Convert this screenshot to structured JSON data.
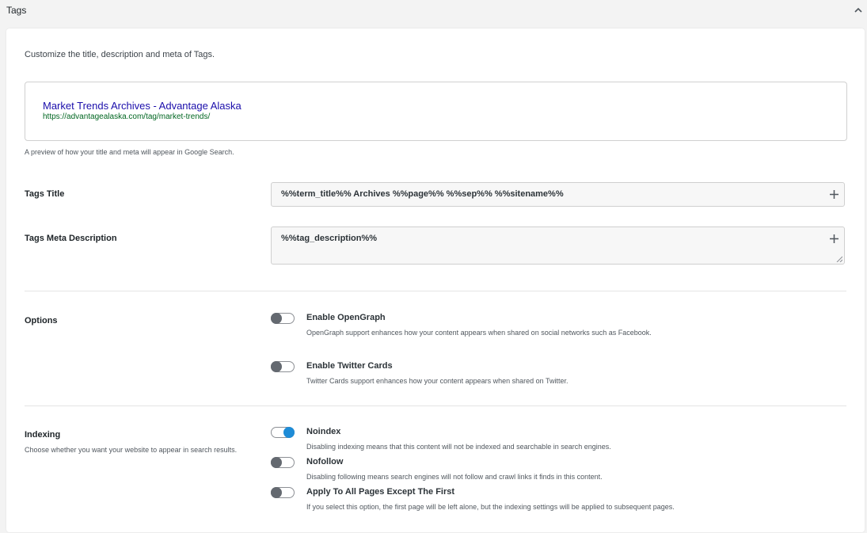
{
  "section": {
    "title": "Tags",
    "collapse_icon": "chevron-up-icon"
  },
  "card": {
    "intro": "Customize the title, description and meta of Tags.",
    "preview": {
      "title": "Market Trends Archives - Advantage Alaska",
      "url": "https://advantagealaska.com/tag/market-trends/",
      "help": "A preview of how your title and meta will appear in Google Search."
    },
    "fields": {
      "title_label": "Tags Title",
      "title_value": "%%term_title%% Archives %%page%% %%sep%% %%sitename%%",
      "description_label": "Tags Meta Description",
      "description_value": "%%tag_description%%",
      "add_icon": "plus-icon"
    },
    "options": {
      "label": "Options",
      "items": [
        {
          "label": "Enable OpenGraph",
          "description": "OpenGraph support enhances how your content appears when shared on social networks such as Facebook.",
          "enabled": false
        },
        {
          "label": "Enable Twitter Cards",
          "description": "Twitter Cards support enhances how your content appears when shared on Twitter.",
          "enabled": false
        }
      ]
    },
    "indexing": {
      "label": "Indexing",
      "help": "Choose whether you want your website to appear in search results.",
      "items": [
        {
          "label": "Noindex",
          "description": "Disabling indexing means that this content will not be indexed and searchable in search engines.",
          "enabled": true
        },
        {
          "label": "Nofollow",
          "description": "Disabling following means search engines will not follow and crawl links it finds in this content.",
          "enabled": false
        },
        {
          "label": "Apply To All Pages Except The First",
          "description": "If you select this option, the first page will be left alone, but the indexing settings will be applied to subsequent pages.",
          "enabled": false
        }
      ]
    },
    "colors": {
      "toggle_on": "#1e8cd7",
      "toggle_off": "#646970",
      "preview_title": "#1a0dab",
      "preview_url": "#006621"
    }
  }
}
